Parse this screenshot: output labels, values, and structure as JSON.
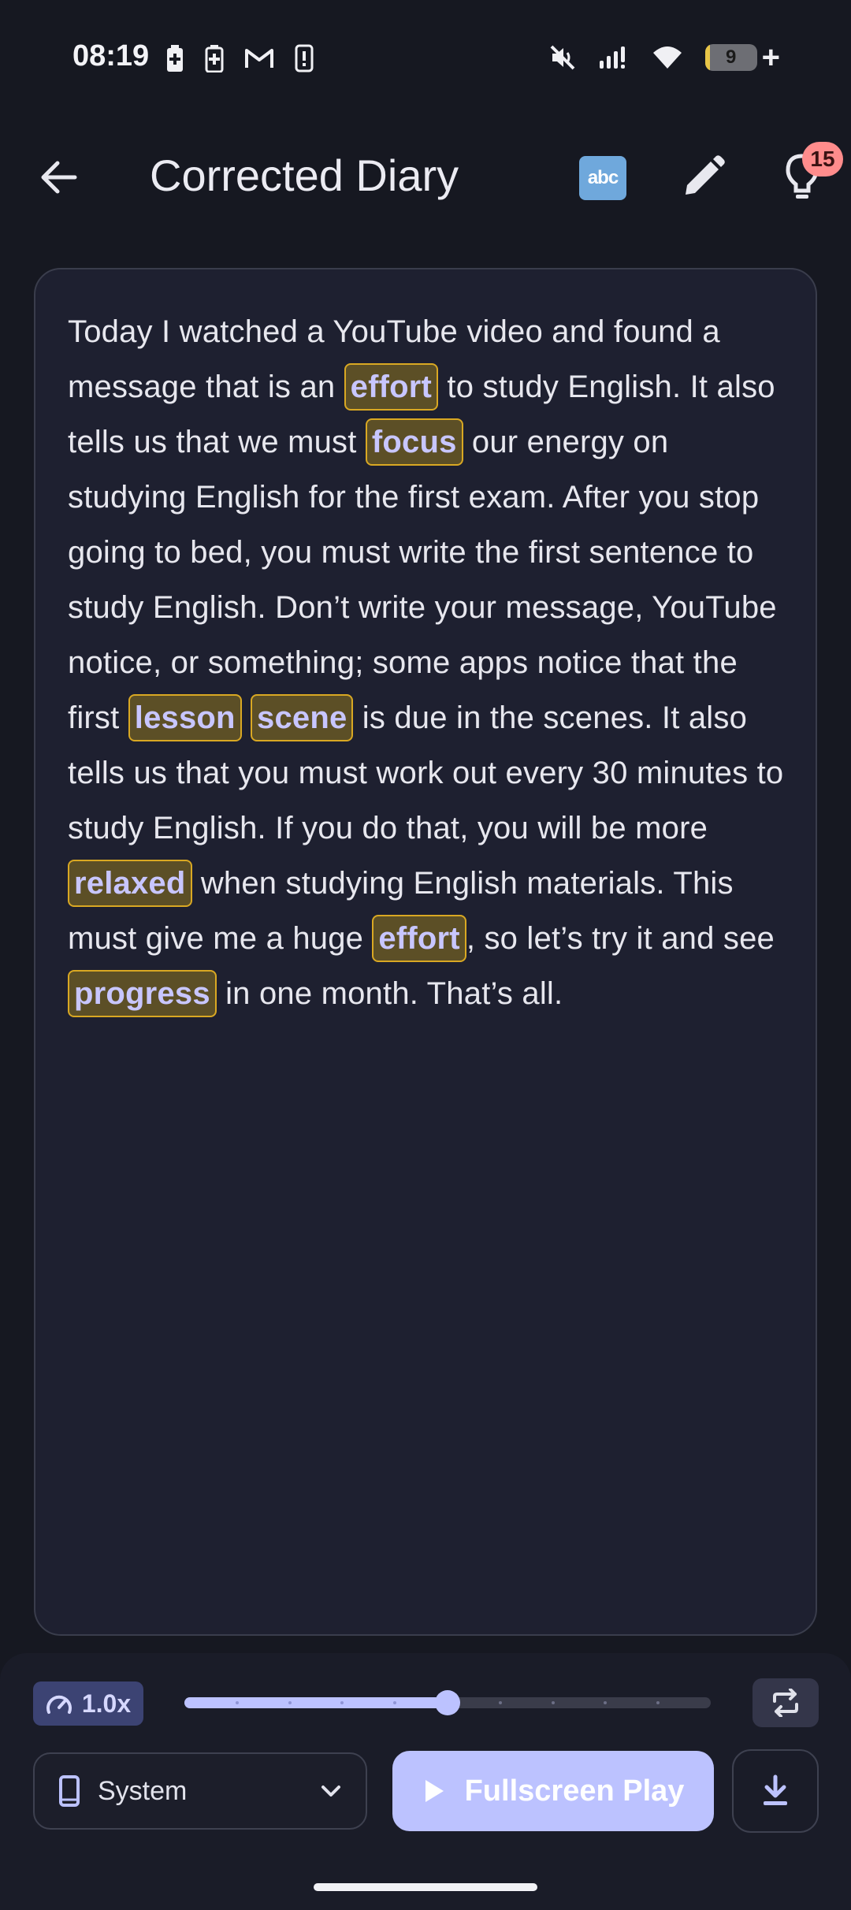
{
  "status_bar": {
    "time": "08:19",
    "battery_level_text": "9",
    "battery_level_percent": 9
  },
  "app_bar": {
    "title": "Corrected Diary",
    "abc_label": "abc",
    "hint_count": "15"
  },
  "diary": {
    "segments": [
      {
        "text": "Today I watched a YouTube video and found a message that is an "
      },
      {
        "text": "effort",
        "highlight": true
      },
      {
        "text": " to study English. It also tells us that we must "
      },
      {
        "text": "focus",
        "highlight": true
      },
      {
        "text": " our energy on studying English for the first exam. After you stop going to bed, you must write the first sentence to study English. Don’t write your message, YouTube notice, or something; some apps notice that the first "
      },
      {
        "text": "lesson",
        "highlight": true
      },
      {
        "text": " "
      },
      {
        "text": "scene",
        "highlight": true
      },
      {
        "text": " is due in the scenes. It also tells us that you must work out every 30 minutes to study English. If you do that, you will be more "
      },
      {
        "text": "relaxed",
        "highlight": true
      },
      {
        "text": " when studying English materials. This must give me a huge "
      },
      {
        "text": "effort",
        "highlight": true
      },
      {
        "text": ", so let’s try it and see "
      },
      {
        "text": "progress",
        "highlight": true
      },
      {
        "text": " in one month. That’s all."
      }
    ]
  },
  "playback": {
    "speed_label": "1.0x",
    "slider_position_fraction": 0.5,
    "slider_steps": 10,
    "voice_label": "System",
    "play_label": "Fullscreen Play"
  },
  "colors": {
    "highlight_bg": "#5c4f26",
    "highlight_border": "#d9a823",
    "highlight_text": "#c8c6ff",
    "accent": "#bcc2ff",
    "badge": "#ff8c8c"
  }
}
